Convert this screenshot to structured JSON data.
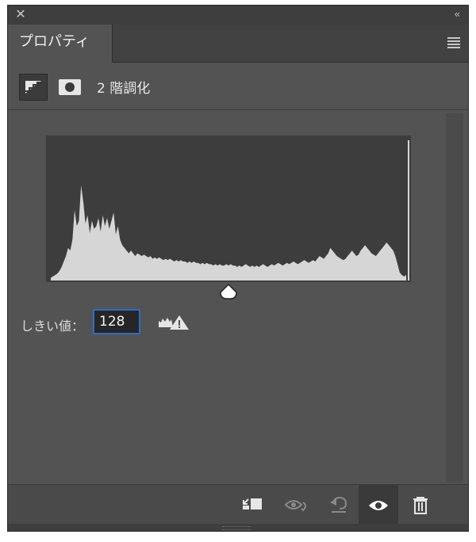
{
  "window": {
    "close_icon": "close-icon",
    "collapse_icon": "double-chevron-left-icon",
    "collapse_glyph": "‹‹",
    "close_glyph": "✕"
  },
  "tab": {
    "label": "プロパティ",
    "menu_icon": "hamburger-menu-icon"
  },
  "adjustment": {
    "title": "2 階調化",
    "layer_icon": "threshold-adjustment-icon",
    "mask_icon": "layer-mask-icon"
  },
  "histogram": {
    "values": [
      2,
      3,
      4,
      5,
      7,
      10,
      14,
      18,
      24,
      22,
      30,
      52,
      40,
      44,
      70,
      58,
      42,
      48,
      35,
      44,
      38,
      40,
      46,
      36,
      48,
      40,
      46,
      38,
      44,
      50,
      34,
      40,
      30,
      26,
      24,
      22,
      20,
      22,
      20,
      18,
      20,
      19,
      18,
      19,
      18,
      17,
      18,
      16,
      17,
      16,
      17,
      16,
      15,
      16,
      15,
      16,
      15,
      14,
      15,
      14,
      15,
      14,
      14,
      13,
      14,
      13,
      14,
      13,
      13,
      12,
      13,
      12,
      13,
      12,
      12,
      11,
      12,
      11,
      12,
      11,
      11,
      12,
      11,
      12,
      11,
      11,
      10,
      11,
      10,
      11,
      12,
      11,
      10,
      11,
      10,
      11,
      10,
      11,
      12,
      11,
      10,
      11,
      12,
      11,
      12,
      13,
      12,
      11,
      12,
      13,
      12,
      13,
      14,
      13,
      12,
      13,
      14,
      15,
      14,
      13,
      14,
      15,
      14,
      16,
      18,
      17,
      16,
      18,
      20,
      24,
      22,
      20,
      18,
      17,
      16,
      15,
      16,
      18,
      20,
      22,
      20,
      18,
      19,
      22,
      24,
      26,
      24,
      22,
      20,
      19,
      18,
      20,
      22,
      24,
      26,
      28,
      26,
      24,
      22,
      18,
      12,
      6,
      4,
      3,
      4
    ]
  },
  "threshold": {
    "label": "しきい値：",
    "value": "128",
    "slider_fraction": 0.5,
    "warning_icon": "histogram-warning-icon"
  },
  "footer": {
    "clip_icon": "clip-to-layer-icon",
    "view_previous_icon": "view-previous-state-icon",
    "reset_icon": "reset-icon",
    "visibility_icon": "eye-icon",
    "delete_icon": "trash-icon"
  }
}
